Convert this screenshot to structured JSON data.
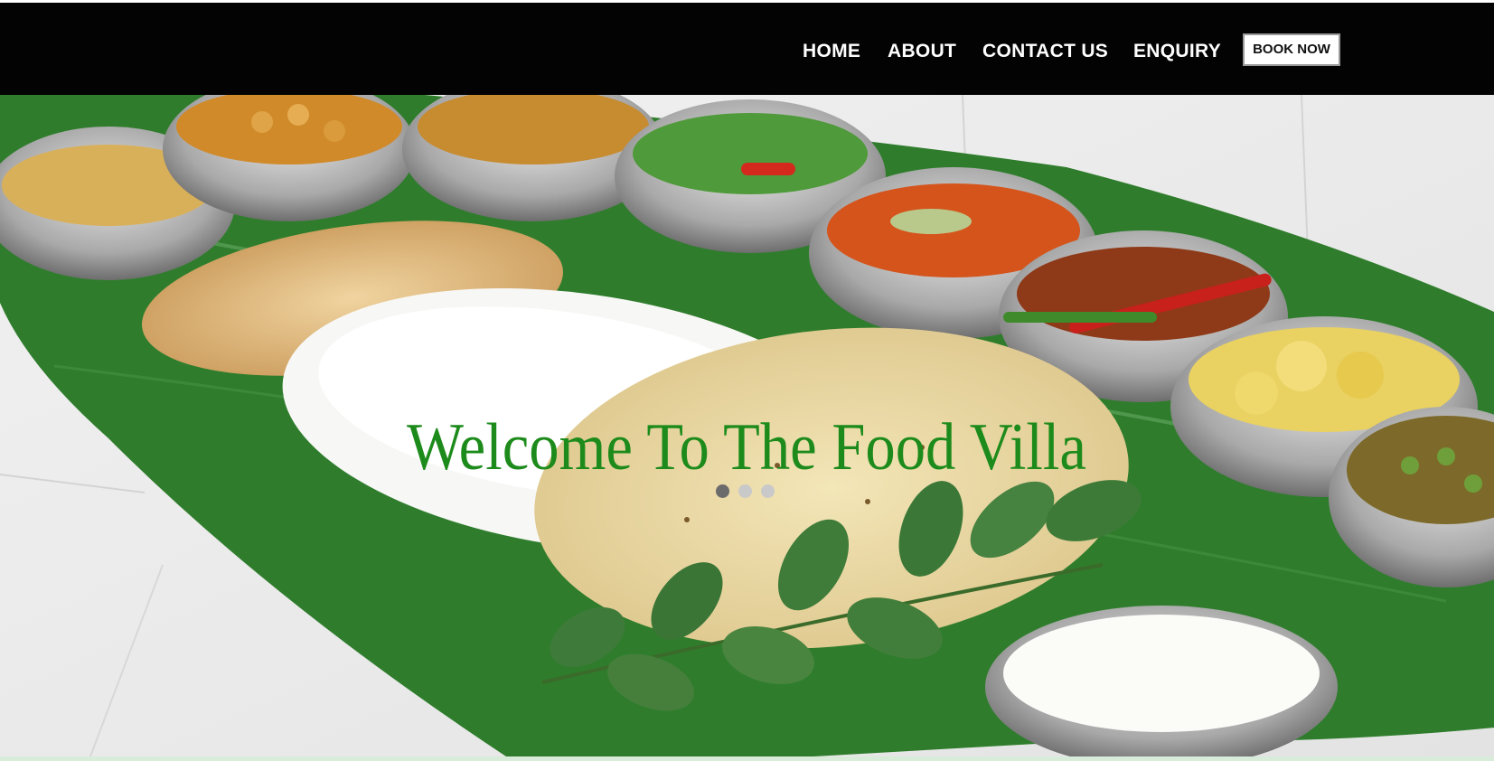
{
  "nav": {
    "items": [
      {
        "label": "HOME"
      },
      {
        "label": "ABOUT"
      },
      {
        "label": "CONTACT US"
      },
      {
        "label": "ENQUIRY"
      }
    ],
    "book_label": "BOOK NOW"
  },
  "hero": {
    "title": "Welcome To The Food Villa",
    "slides": {
      "count": 3,
      "active": 1
    }
  },
  "colors": {
    "navbar": "#030303",
    "title": "#1d8b1b",
    "leaf": "#2f7d2c",
    "dot_active": "#6b6b6b",
    "dot_inactive": "#c9c9c9"
  }
}
